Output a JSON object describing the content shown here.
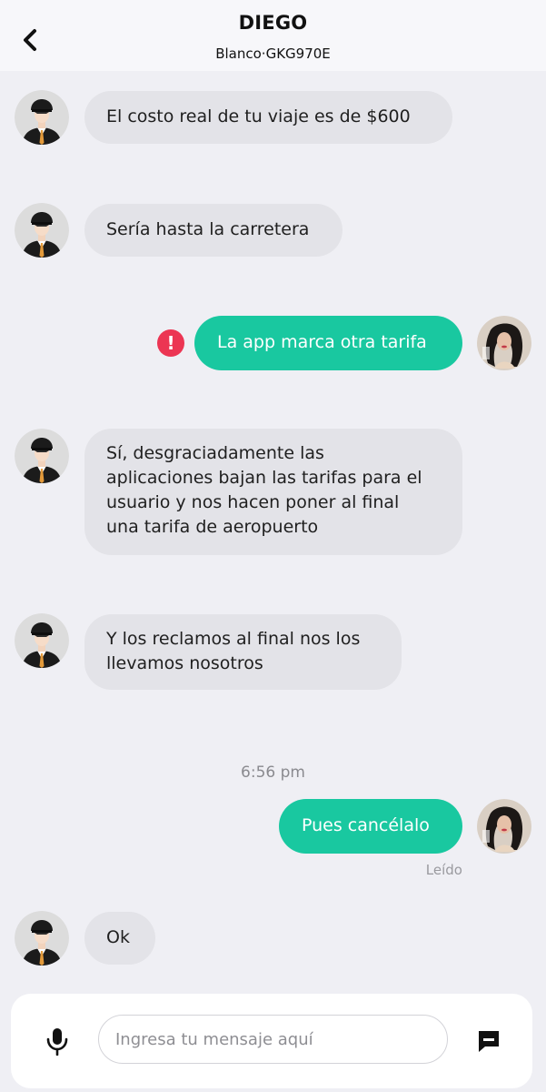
{
  "header": {
    "title": "DIEGO",
    "subtitle": "Blanco·GKG970E"
  },
  "messages": [
    {
      "from": "driver",
      "text": "El costo real de tu viaje es de $600"
    },
    {
      "from": "driver",
      "text": "Sería hasta la carretera"
    },
    {
      "from": "user",
      "text": "La app marca otra tarifa",
      "status": "error"
    },
    {
      "from": "driver",
      "lines": [
        "Sí, desgraciadamente las",
        "aplicaciones bajan las tarifas para el",
        "usuario y nos hacen poner al final",
        "una tarifa de aeropuerto"
      ]
    },
    {
      "from": "driver",
      "lines": [
        "Y los reclamos al final nos los",
        "llevamos nosotros"
      ]
    },
    {
      "from": "user",
      "text": "Pues cancélalo"
    },
    {
      "from": "driver",
      "text": "Ok"
    }
  ],
  "timestamp": "6:56 pm",
  "read_receipt": "Leído",
  "input": {
    "placeholder": "Ingresa tu mensaje aquí",
    "value": ""
  },
  "icons": {
    "back": "chevron-left-icon",
    "error": "exclamation-icon",
    "mic": "microphone-icon",
    "send": "message-icon"
  },
  "colors": {
    "background": "#efeff4",
    "incoming_bubble": "#e3e3e8",
    "outgoing_bubble": "#19c8a0",
    "error": "#ec3553",
    "timestamp": "#8a8a8f"
  }
}
